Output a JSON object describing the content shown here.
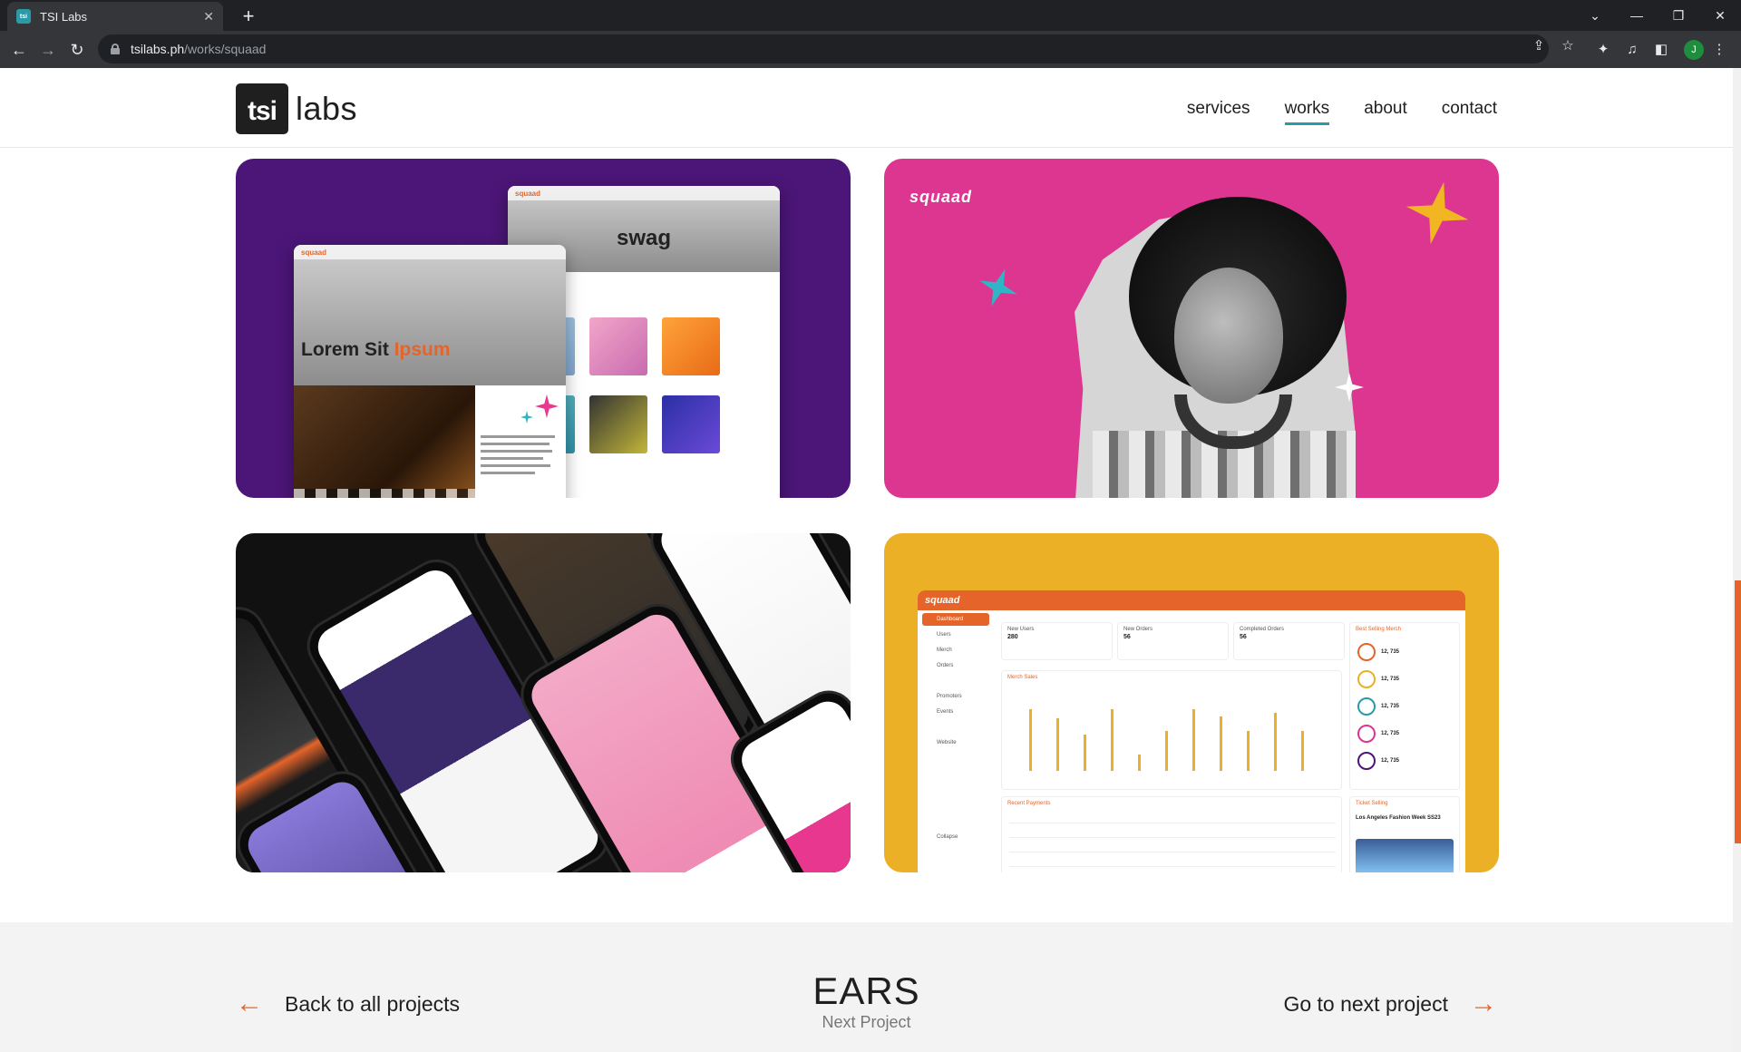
{
  "browser": {
    "tab_title": "TSI Labs",
    "favicon_text": "tsi",
    "url_host": "tsilabs.ph",
    "url_path": "/works/squaad",
    "profile_initial": "J"
  },
  "header": {
    "logo_box": "tsi",
    "logo_word": "labs",
    "nav": [
      {
        "label": "services",
        "active": false
      },
      {
        "label": "works",
        "active": true
      },
      {
        "label": "about",
        "active": false
      },
      {
        "label": "contact",
        "active": false
      }
    ]
  },
  "gallery": {
    "card1": {
      "back_title": "swag",
      "front_title_a": "Lorem Sit",
      "front_title_b": "Ipsum",
      "logo": "squaad"
    },
    "card2": {
      "logo": "squaad"
    },
    "card4": {
      "logo": "squaad",
      "sidebar": [
        "Dashboard",
        "Users",
        "Merch",
        "Orders",
        "Promoters",
        "Events",
        "Website",
        "Collapse"
      ],
      "stats": [
        {
          "label": "New Users",
          "value": "280"
        },
        {
          "label": "New Orders",
          "value": "56"
        },
        {
          "label": "Completed Orders",
          "value": "56"
        }
      ],
      "chart_title": "Merch Sales",
      "payments_title": "Recent Payments",
      "best_title": "Best Selling Merch",
      "best_value": "12, 735",
      "ticket_title": "Ticket Selling",
      "ticket_event": "Los Angeles Fashion Week SS23"
    }
  },
  "footer": {
    "back_label": "Back to all projects",
    "next_label": "Go to next project",
    "next_project_name": "EARS",
    "next_project_sub": "Next Project"
  },
  "colors": {
    "accent_orange": "#e5642a",
    "accent_teal": "#2a9aa8",
    "purple": "#4b1677",
    "pink": "#dc3690",
    "yellow": "#ebb026"
  }
}
